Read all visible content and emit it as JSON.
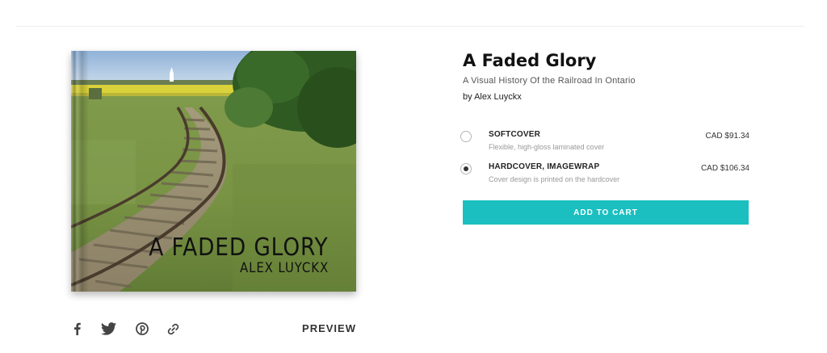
{
  "book": {
    "title": "A Faded Glory",
    "subtitle": "A Visual History Of the Railroad In Ontario",
    "author_line": "by Alex Luyckx",
    "cover": {
      "title_text": "A FADED GLORY",
      "author_text": "ALEX LUYCKX"
    }
  },
  "options": [
    {
      "name": "SOFTCOVER",
      "description": "Flexible, high-gloss laminated cover",
      "price": "CAD $91.34",
      "selected": false
    },
    {
      "name": "HARDCOVER, IMAGEWRAP",
      "description": "Cover design is printed on the hardcover",
      "price": "CAD $106.34",
      "selected": true
    }
  ],
  "cart_button_label": "ADD TO CART",
  "share": {
    "icons": [
      "facebook-icon",
      "twitter-icon",
      "pinterest-icon",
      "link-icon"
    ],
    "preview_label": "PREVIEW"
  },
  "colors": {
    "accent": "#1bbfbf",
    "text_dark": "#111111",
    "text_muted": "#999999"
  }
}
